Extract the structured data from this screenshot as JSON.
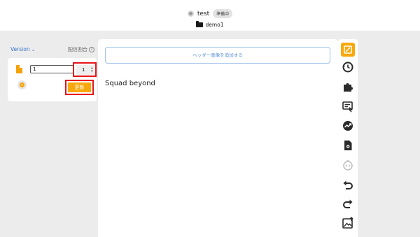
{
  "header": {
    "title": "test",
    "status_badge": "準備中",
    "folder_name": "demo1"
  },
  "left_panel": {
    "version_label": "Version",
    "ratio_label": "配信割合",
    "variant": {
      "name_value": "1",
      "ratio_value": "1",
      "update_label": "更新"
    }
  },
  "main": {
    "add_header_image_label": "ヘッダー画像を追加する",
    "content_text": "Squad beyond"
  },
  "toolbar": {
    "tools": [
      "image-block-icon",
      "history-icon",
      "puzzle-icon",
      "form-click-icon",
      "conversion-icon",
      "file-settings-icon",
      "code-icon",
      "undo-icon",
      "redo-icon",
      "image-upload-icon"
    ]
  },
  "colors": {
    "accent": "#f7a80c",
    "link": "#3a72c4",
    "highlight": "#e8141a",
    "icon": "#2b2b2b"
  }
}
